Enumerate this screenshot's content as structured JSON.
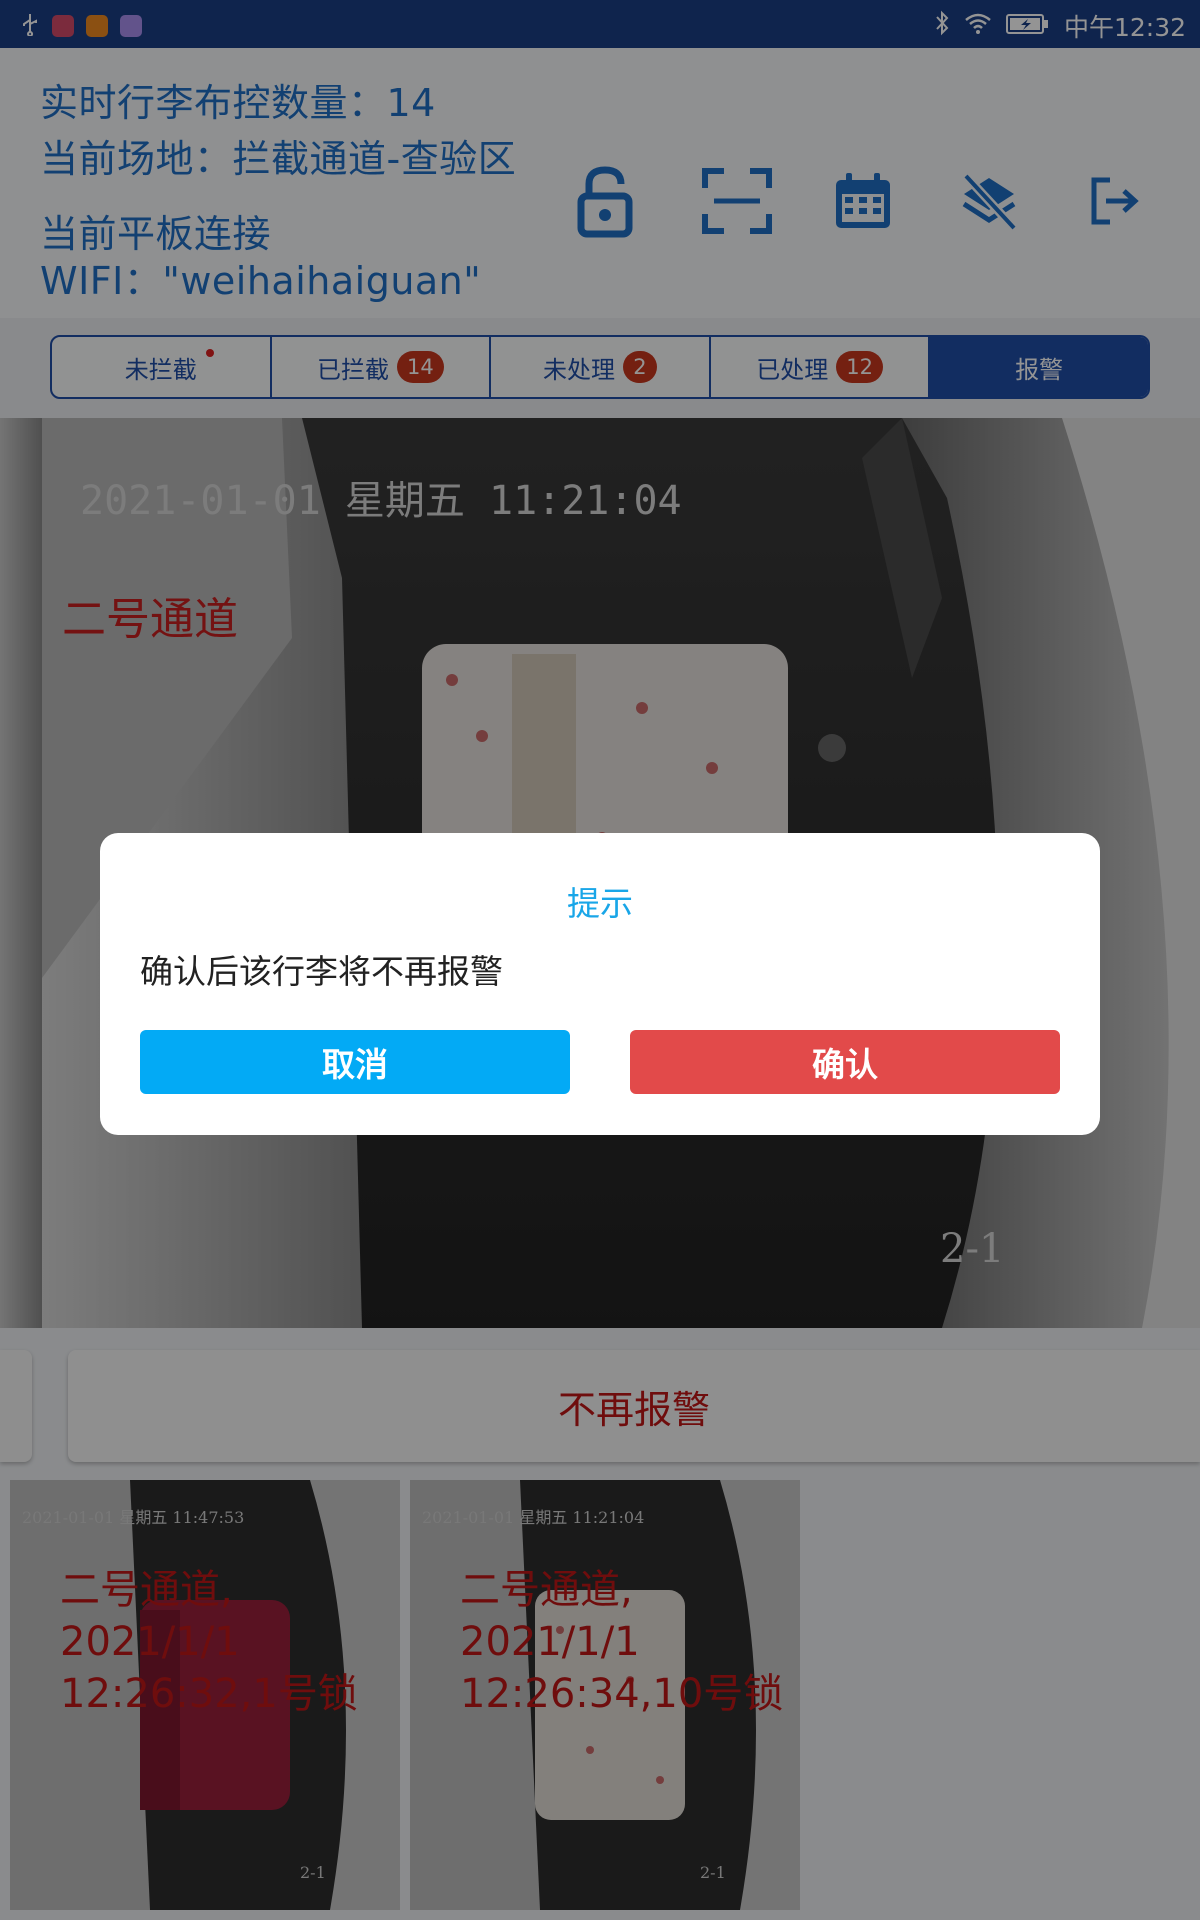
{
  "status_bar": {
    "time": "中午12:32"
  },
  "header": {
    "live_count": "实时行李布控数量：14",
    "location": "当前场地：拦截通道-查验区",
    "tablet_label": "当前平板连接",
    "wifi": "WIFI：\"weihaihaiguan\""
  },
  "toolbar": {
    "icons": [
      "lock-open-icon",
      "scan-icon",
      "calendar-icon",
      "layers-off-icon",
      "logout-icon"
    ]
  },
  "tabs": [
    {
      "label": "未拦截",
      "badge": "",
      "dot": true,
      "active": false
    },
    {
      "label": "已拦截",
      "badge": "14",
      "active": false
    },
    {
      "label": "未处理",
      "badge": "2",
      "active": false
    },
    {
      "label": "已处理",
      "badge": "12",
      "active": false
    },
    {
      "label": "报警",
      "badge": "",
      "active": true
    }
  ],
  "main_image": {
    "timestamp": "2021-01-01 星期五 11:21:04",
    "channel": "二号通道",
    "camera_id": "2-1"
  },
  "action": {
    "no_alarm_label": "不再报警"
  },
  "thumbnails": [
    {
      "timestamp": "2021-01-01 星期五 11:47:53",
      "caption": "二号通道,\n2021/1/1\n12:26:32,1号锁",
      "camera_id": "2-1"
    },
    {
      "timestamp": "2021-01-01 星期五 11:21:04",
      "caption": "二号通道,\n2021/1/1\n12:26:34,10号锁",
      "camera_id": "2-1"
    }
  ],
  "dialog": {
    "title": "提示",
    "message": "确认后该行李将不再报警",
    "cancel_label": "取消",
    "confirm_label": "确认"
  },
  "colors": {
    "status_bar": "#1b3e86",
    "primary": "#1f4ea8",
    "info_text": "#1f6fc4",
    "alarm_red": "#c01818",
    "cancel_btn": "#03aaf5",
    "confirm_btn": "#e24a4a",
    "dialog_title": "#19a6e8"
  }
}
